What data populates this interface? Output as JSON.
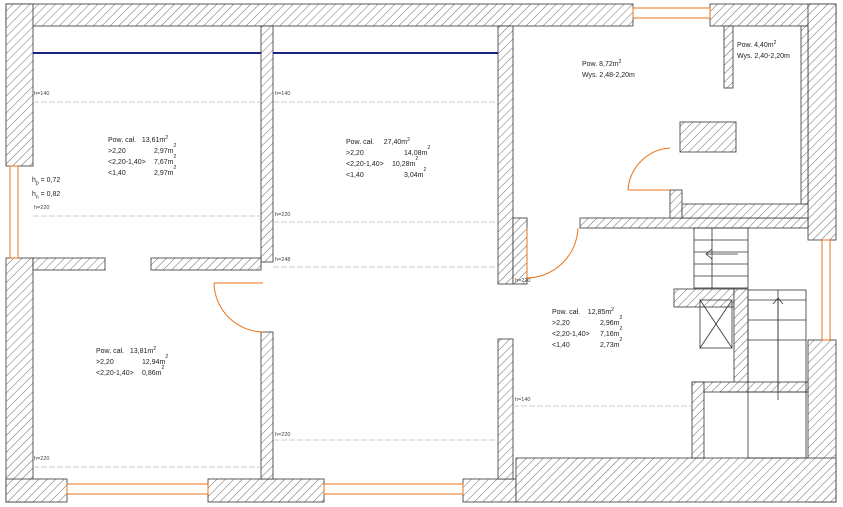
{
  "colors": {
    "wall_hatch": "#555555",
    "door": "#e8761e",
    "window": "#e8761e",
    "beam": "#1a237e",
    "height_line": "#bbbbbb",
    "text": "#222222"
  },
  "rooms": {
    "top_left": {
      "title": "Pow. cał.",
      "total": "13,61m",
      "rows": [
        {
          "k": ">2,20",
          "v": "2,97m"
        },
        {
          "k": "<2,20-1,40>",
          "v": "7,67m"
        },
        {
          "k": "<1,40",
          "v": "2,97m"
        }
      ]
    },
    "top_mid": {
      "title": "Pow. cał.",
      "total": "27,40m",
      "rows": [
        {
          "k": ">2,20",
          "v": "14,08m"
        },
        {
          "k": "<2,20-1,40>",
          "v": "10,28m"
        },
        {
          "k": "<1,40",
          "v": "3,04m"
        }
      ]
    },
    "top_right": {
      "title": "Pow. 8,72m",
      "sub": "Wys. 2,48-2,20m"
    },
    "small": {
      "title": "Pow. 4,40m",
      "sub": "Wys. 2,40-2,20m"
    },
    "bottom_left": {
      "title": "Pow. cał.",
      "total": "13,81m",
      "rows": [
        {
          "k": ">2,20",
          "v": "12,94m"
        },
        {
          "k": "<2,20-1,40>",
          "v": "0,86m"
        }
      ]
    },
    "bottom_right": {
      "title": "Pow. cał.",
      "total": "12,85m",
      "rows": [
        {
          "k": ">2,20",
          "v": "2,96m"
        },
        {
          "k": "<2,20-1,40>",
          "v": "7,16m"
        },
        {
          "k": "<1,40",
          "v": "2,73m"
        }
      ]
    }
  },
  "sup2": "2",
  "window_heights": {
    "hp": "= 0,72",
    "hn": "= 0,82",
    "hp_sym": "h",
    "hp_sub": "p",
    "hn_sym": "h",
    "hn_sub": "n"
  },
  "height_marks": {
    "h140": "h=140",
    "h220": "h=220",
    "h248": "h=248"
  }
}
